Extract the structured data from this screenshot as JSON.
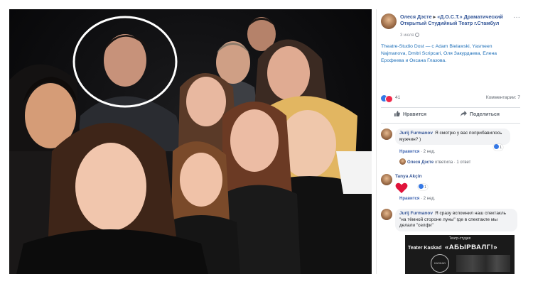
{
  "post": {
    "author": "Олеся Дэсте",
    "arrow": "▸",
    "page": "«Д.О.С.Т.» Драматический Открытый Студийный Театр г.Стамбул",
    "timestamp": "3 июля",
    "more": "···",
    "text": "Theatre-Studio Dost — с Adam Bielawski, Yasmeen Najmanova, Dmitri Scripcari, Оля Закурдаева, Елена Ерофеева и Оксана Глазова.",
    "reaction_count": "41",
    "comments_count": "Комментарии: 7",
    "like_label": "Нравится",
    "share_label": "Поделиться"
  },
  "comments": [
    {
      "name": "Jurij Furmanov",
      "text": "Я смотрю у вас поприбавилось мужчин? )",
      "like": "Нравится",
      "time": "2 нед.",
      "badge": "1",
      "reply_author": "Олеся Дэсте",
      "reply_text": "ответила · 1 ответ"
    },
    {
      "name": "Tanya Akçin",
      "badge": "1",
      "like": "Нравится",
      "time": "2 нед."
    },
    {
      "name": "Jurij Furmanov",
      "text": "Я сразу вспомнил наш спектакль \"на тёмной стороне луны\" где в спектакле мы делали \"селфи\"",
      "like": "Нравится",
      "time": "2 нед."
    }
  ],
  "ad": {
    "top": "Театр-студия",
    "left": "Teater Kaskad",
    "title": "«АБЫРВАЛГ!»",
    "logo": "KASKAD"
  },
  "colors": {
    "link": "#365899",
    "highlight_circle": "#ffffff",
    "like_blue": "#3578e5",
    "love_red": "#f0284a"
  }
}
